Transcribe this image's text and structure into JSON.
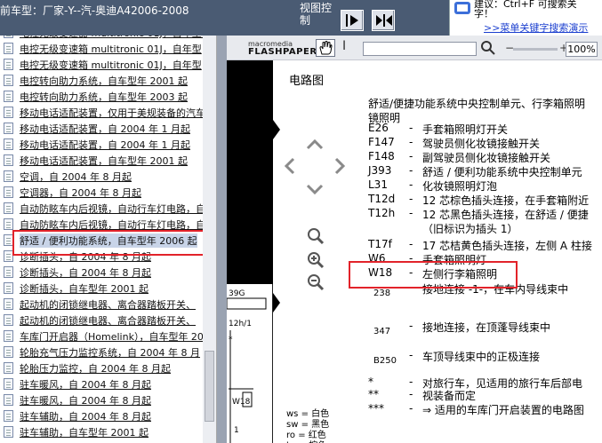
{
  "topbar": {
    "title": "前车型：厂家-Y--汽-奥迪A42006-2008",
    "view_control": "视图控制",
    "help_line1": "建议：Ctrl+F 可搜索关",
    "help_line2": "字！",
    "help_link": ">>菜单关键字搜索演示"
  },
  "left_list": {
    "items": [
      "电控无级变速器 multitronic 01J，自年型年 2",
      "电控无级变速箱 multitronic 01J，自年型",
      "电控无级变速箱 multitronic 01J，自年型",
      "电控转向助力系统，自车型年 2001 起",
      "电控转向助力系统，自车型年 2003 起",
      "移动电话适配装置，仅用于美规装备的汽车",
      "移动电话适配装置，自 2004 年 1 月起",
      "移动电话适配装置，自 2004 年 1 月起",
      "移动电话适配装置，自车型年 2001 起",
      "空调，自 2004 年 8 月起",
      "空调器，自 2004 年 8 月起",
      "自动防眩车内后视镜，自动行车灯电路，自",
      "自动防眩车内后视镜，自动行车灯电路，自",
      "舒适 / 便利功能系统，自车型年 2006 起",
      "诊断插头，自 2004 年 8 月起",
      "诊断插头，自 2004 年 8 月起",
      "诊断插头，自车型年 2001 起",
      "起动机的闭锁继电器、离合器踏板开关、",
      "起动机的闭锁继电器、离合器踏板开关、",
      "车库门开启器（Homelink），自车型年 20",
      "轮胎充气压力监控系统，自 2004 年 8 月",
      "轮胎压力监控，自 2004 年 8 月起",
      "驻车暖风，自 2004 年 8 月起",
      "驻车暖风，自 2004 年 8 月起",
      "驻车辅助，自 2004 年 8 月起",
      "驻车辅助，自车型年 2001 起"
    ],
    "selected_index": 13
  },
  "flash_toolbar": {
    "logo_small": "macromedia",
    "logo_big": "FLASHPAPER",
    "text_tool": "I",
    "zoom_minus": "−",
    "zoom_plus": "+",
    "zoom": "100%"
  },
  "document": {
    "title": "电路图",
    "legend_header_1": "舒适/便捷功能系统中央控制单元、行李箱照明",
    "legend_header_2": "镜照明",
    "legend": [
      {
        "code": "E26",
        "desc": "手套箱照明灯开关"
      },
      {
        "code": "F147",
        "desc": "驾驶员侧化妆镜接触开关"
      },
      {
        "code": "F148",
        "desc": "副驾驶员侧化妆镜接触开关"
      },
      {
        "code": "J393",
        "desc": "舒适 / 便利功能系统中央控制单元"
      },
      {
        "code": "L31",
        "desc": "化妆镜照明灯泡"
      },
      {
        "code": "T12d",
        "desc": "12 芯棕色插头连接，在手套箱附近"
      },
      {
        "code": "T12h",
        "desc": "12 芯黑色插头连接，在舒适 / 便捷"
      },
      {
        "code": "",
        "desc": "（旧标识为插头 1）"
      },
      {
        "code": "T17f",
        "desc": "17 芯桔黄色插头连接，左侧 A 柱接"
      },
      {
        "code": "W6",
        "desc": "手套箱照明灯"
      },
      {
        "code": "W18",
        "desc": "左侧行李箱照明"
      },
      {
        "code": "238",
        "desc": "接地连接 -1-，在车内导线束中"
      },
      {
        "code": "347",
        "desc": "接地连接，在顶蓬导线束中"
      },
      {
        "code": "B250",
        "desc": "车顶导线束中的正极连接"
      },
      {
        "code": "*",
        "desc": "对旅行车，见适用的旅行车后部电"
      },
      {
        "code": "**",
        "desc": "视装备而定"
      },
      {
        "code": "***",
        "desc": "⇒ 适用的车库门开启装置的电路图"
      }
    ],
    "diagram_labels": [
      "39G",
      "12h/1",
      "*",
      "W18",
      "1"
    ],
    "wire_colors": [
      {
        "abbr": "ws",
        "name": "白色"
      },
      {
        "abbr": "sw",
        "name": "黑色"
      },
      {
        "abbr": "ro",
        "name": "红色"
      },
      {
        "abbr": "br",
        "name": "棕色"
      }
    ]
  },
  "colors": {
    "topbar": "#4a5b73",
    "highlight": "#e2232a",
    "link": "#1b3fcf"
  }
}
